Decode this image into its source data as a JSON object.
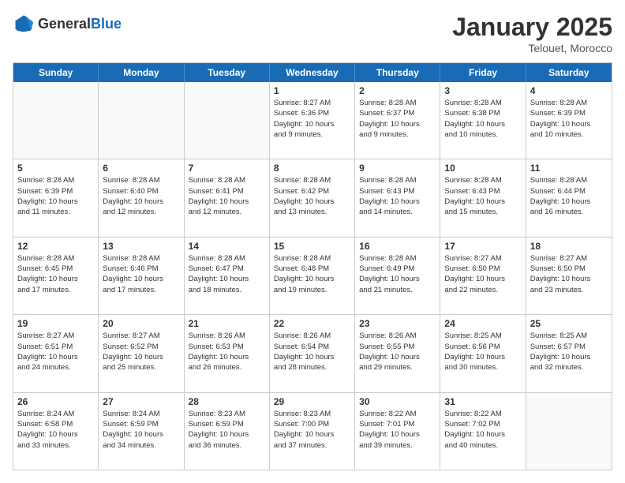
{
  "header": {
    "logo_general": "General",
    "logo_blue": "Blue",
    "month_title": "January 2025",
    "location": "Telouet, Morocco"
  },
  "days_of_week": [
    "Sunday",
    "Monday",
    "Tuesday",
    "Wednesday",
    "Thursday",
    "Friday",
    "Saturday"
  ],
  "rows": [
    [
      {
        "date": "",
        "empty": true
      },
      {
        "date": "",
        "empty": true
      },
      {
        "date": "",
        "empty": true
      },
      {
        "date": "1",
        "sunrise": "Sunrise: 8:27 AM",
        "sunset": "Sunset: 6:36 PM",
        "daylight": "Daylight: 10 hours and 9 minutes."
      },
      {
        "date": "2",
        "sunrise": "Sunrise: 8:28 AM",
        "sunset": "Sunset: 6:37 PM",
        "daylight": "Daylight: 10 hours and 9 minutes."
      },
      {
        "date": "3",
        "sunrise": "Sunrise: 8:28 AM",
        "sunset": "Sunset: 6:38 PM",
        "daylight": "Daylight: 10 hours and 10 minutes."
      },
      {
        "date": "4",
        "sunrise": "Sunrise: 8:28 AM",
        "sunset": "Sunset: 6:39 PM",
        "daylight": "Daylight: 10 hours and 10 minutes."
      }
    ],
    [
      {
        "date": "5",
        "sunrise": "Sunrise: 8:28 AM",
        "sunset": "Sunset: 6:39 PM",
        "daylight": "Daylight: 10 hours and 11 minutes."
      },
      {
        "date": "6",
        "sunrise": "Sunrise: 8:28 AM",
        "sunset": "Sunset: 6:40 PM",
        "daylight": "Daylight: 10 hours and 12 minutes."
      },
      {
        "date": "7",
        "sunrise": "Sunrise: 8:28 AM",
        "sunset": "Sunset: 6:41 PM",
        "daylight": "Daylight: 10 hours and 12 minutes."
      },
      {
        "date": "8",
        "sunrise": "Sunrise: 8:28 AM",
        "sunset": "Sunset: 6:42 PM",
        "daylight": "Daylight: 10 hours and 13 minutes."
      },
      {
        "date": "9",
        "sunrise": "Sunrise: 8:28 AM",
        "sunset": "Sunset: 6:43 PM",
        "daylight": "Daylight: 10 hours and 14 minutes."
      },
      {
        "date": "10",
        "sunrise": "Sunrise: 8:28 AM",
        "sunset": "Sunset: 6:43 PM",
        "daylight": "Daylight: 10 hours and 15 minutes."
      },
      {
        "date": "11",
        "sunrise": "Sunrise: 8:28 AM",
        "sunset": "Sunset: 6:44 PM",
        "daylight": "Daylight: 10 hours and 16 minutes."
      }
    ],
    [
      {
        "date": "12",
        "sunrise": "Sunrise: 8:28 AM",
        "sunset": "Sunset: 6:45 PM",
        "daylight": "Daylight: 10 hours and 17 minutes."
      },
      {
        "date": "13",
        "sunrise": "Sunrise: 8:28 AM",
        "sunset": "Sunset: 6:46 PM",
        "daylight": "Daylight: 10 hours and 17 minutes."
      },
      {
        "date": "14",
        "sunrise": "Sunrise: 8:28 AM",
        "sunset": "Sunset: 6:47 PM",
        "daylight": "Daylight: 10 hours and 18 minutes."
      },
      {
        "date": "15",
        "sunrise": "Sunrise: 8:28 AM",
        "sunset": "Sunset: 6:48 PM",
        "daylight": "Daylight: 10 hours and 19 minutes."
      },
      {
        "date": "16",
        "sunrise": "Sunrise: 8:28 AM",
        "sunset": "Sunset: 6:49 PM",
        "daylight": "Daylight: 10 hours and 21 minutes."
      },
      {
        "date": "17",
        "sunrise": "Sunrise: 8:27 AM",
        "sunset": "Sunset: 6:50 PM",
        "daylight": "Daylight: 10 hours and 22 minutes."
      },
      {
        "date": "18",
        "sunrise": "Sunrise: 8:27 AM",
        "sunset": "Sunset: 6:50 PM",
        "daylight": "Daylight: 10 hours and 23 minutes."
      }
    ],
    [
      {
        "date": "19",
        "sunrise": "Sunrise: 8:27 AM",
        "sunset": "Sunset: 6:51 PM",
        "daylight": "Daylight: 10 hours and 24 minutes."
      },
      {
        "date": "20",
        "sunrise": "Sunrise: 8:27 AM",
        "sunset": "Sunset: 6:52 PM",
        "daylight": "Daylight: 10 hours and 25 minutes."
      },
      {
        "date": "21",
        "sunrise": "Sunrise: 8:26 AM",
        "sunset": "Sunset: 6:53 PM",
        "daylight": "Daylight: 10 hours and 26 minutes."
      },
      {
        "date": "22",
        "sunrise": "Sunrise: 8:26 AM",
        "sunset": "Sunset: 6:54 PM",
        "daylight": "Daylight: 10 hours and 28 minutes."
      },
      {
        "date": "23",
        "sunrise": "Sunrise: 8:26 AM",
        "sunset": "Sunset: 6:55 PM",
        "daylight": "Daylight: 10 hours and 29 minutes."
      },
      {
        "date": "24",
        "sunrise": "Sunrise: 8:25 AM",
        "sunset": "Sunset: 6:56 PM",
        "daylight": "Daylight: 10 hours and 30 minutes."
      },
      {
        "date": "25",
        "sunrise": "Sunrise: 8:25 AM",
        "sunset": "Sunset: 6:57 PM",
        "daylight": "Daylight: 10 hours and 32 minutes."
      }
    ],
    [
      {
        "date": "26",
        "sunrise": "Sunrise: 8:24 AM",
        "sunset": "Sunset: 6:58 PM",
        "daylight": "Daylight: 10 hours and 33 minutes."
      },
      {
        "date": "27",
        "sunrise": "Sunrise: 8:24 AM",
        "sunset": "Sunset: 6:59 PM",
        "daylight": "Daylight: 10 hours and 34 minutes."
      },
      {
        "date": "28",
        "sunrise": "Sunrise: 8:23 AM",
        "sunset": "Sunset: 6:59 PM",
        "daylight": "Daylight: 10 hours and 36 minutes."
      },
      {
        "date": "29",
        "sunrise": "Sunrise: 8:23 AM",
        "sunset": "Sunset: 7:00 PM",
        "daylight": "Daylight: 10 hours and 37 minutes."
      },
      {
        "date": "30",
        "sunrise": "Sunrise: 8:22 AM",
        "sunset": "Sunset: 7:01 PM",
        "daylight": "Daylight: 10 hours and 39 minutes."
      },
      {
        "date": "31",
        "sunrise": "Sunrise: 8:22 AM",
        "sunset": "Sunset: 7:02 PM",
        "daylight": "Daylight: 10 hours and 40 minutes."
      },
      {
        "date": "",
        "empty": true
      }
    ]
  ]
}
